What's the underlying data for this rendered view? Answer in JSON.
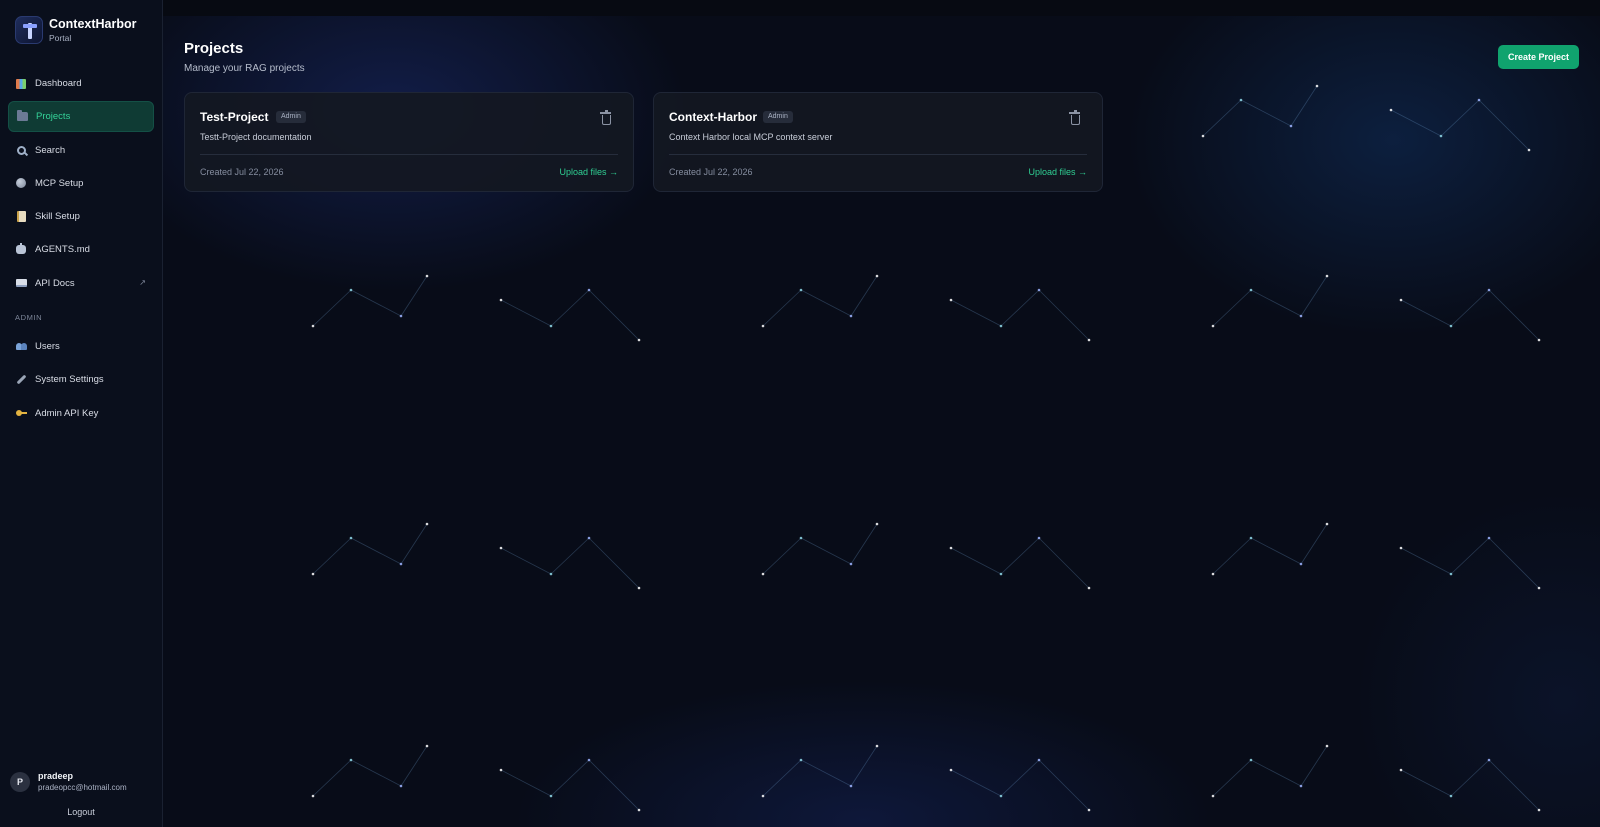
{
  "brand": {
    "name": "ContextHarbor",
    "subtitle": "Portal"
  },
  "sidebar": {
    "items": [
      {
        "label": "Dashboard",
        "icon": "dashboard-icon",
        "active": false
      },
      {
        "label": "Projects",
        "icon": "folder-icon",
        "active": true
      },
      {
        "label": "Search",
        "icon": "search-icon",
        "active": false
      },
      {
        "label": "MCP Setup",
        "icon": "globe-icon",
        "active": false
      },
      {
        "label": "Skill Setup",
        "icon": "note-icon",
        "active": false
      },
      {
        "label": "AGENTS.md",
        "icon": "robot-icon",
        "active": false
      },
      {
        "label": "API Docs",
        "icon": "book-icon",
        "active": false,
        "external_icon": "external-link-icon",
        "external_glyph": "↗"
      }
    ],
    "admin_section_label": "ADMIN",
    "admin_items": [
      {
        "label": "Users",
        "icon": "users-icon"
      },
      {
        "label": "System Settings",
        "icon": "wrench-icon"
      },
      {
        "label": "Admin API Key",
        "icon": "key-icon"
      }
    ]
  },
  "user": {
    "initial": "P",
    "name": "pradeep",
    "email": "pradeopcc@hotmail.com",
    "logout_label": "Logout"
  },
  "header": {
    "title": "Projects",
    "subtitle": "Manage your RAG projects",
    "create_button_label": "Create Project"
  },
  "projects": [
    {
      "name": "Test-Project",
      "badge": "Admin",
      "description": "Testt-Project documentation",
      "created": "Created Jul 22, 2026",
      "upload_label": "Upload files →"
    },
    {
      "name": "Context-Harbor",
      "badge": "Admin",
      "description": "Context Harbor local MCP context server",
      "created": "Created Jul 22, 2026",
      "upload_label": "Upload files →"
    }
  ],
  "colors": {
    "accent": "#10a36e",
    "accent_text": "#34d399",
    "sidebar_bg": "#0a0f1c",
    "page_bg": "#080c18",
    "card_bg": "#141822"
  }
}
